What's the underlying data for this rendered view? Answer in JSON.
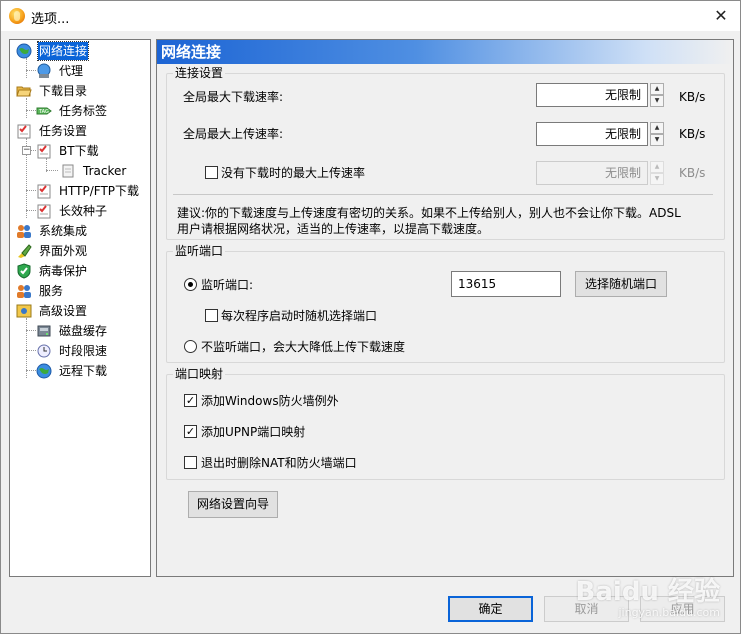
{
  "window": {
    "title": "选项..."
  },
  "tree": {
    "items": [
      {
        "label": "网络连接",
        "icon": "globe-icon",
        "selected": true
      },
      {
        "label": "代理",
        "icon": "network-icon"
      },
      {
        "label": "下载目录",
        "icon": "folder-open-icon"
      },
      {
        "label": "任务标签",
        "icon": "tag-icon"
      },
      {
        "label": "任务设置",
        "icon": "task-icon"
      },
      {
        "label": "BT下载",
        "icon": "task-icon"
      },
      {
        "label": "Tracker",
        "icon": "page-icon"
      },
      {
        "label": "HTTP/FTP下载",
        "icon": "task-icon"
      },
      {
        "label": "长效种子",
        "icon": "task-icon"
      },
      {
        "label": "系统集成",
        "icon": "users-icon"
      },
      {
        "label": "界面外观",
        "icon": "brush-icon"
      },
      {
        "label": "病毒保护",
        "icon": "shield-icon"
      },
      {
        "label": "服务",
        "icon": "users-icon"
      },
      {
        "label": "高级设置",
        "icon": "advanced-icon"
      },
      {
        "label": "磁盘缓存",
        "icon": "disk-icon"
      },
      {
        "label": "时段限速",
        "icon": "clock-icon"
      },
      {
        "label": "远程下载",
        "icon": "globe-icon"
      }
    ]
  },
  "panel": {
    "header": "网络连接",
    "connection": {
      "title": "连接设置",
      "max_download_label": "全局最大下载速率:",
      "max_download_value": "无限制",
      "max_upload_label": "全局最大上传速率:",
      "max_upload_value": "无限制",
      "idle_upload_label": "没有下载时的最大上传速率",
      "idle_upload_value": "无限制",
      "unit": "KB/s",
      "advice_line1": "建议:你的下载速度与上传速度有密切的关系。如果不上传给别人，别人也不会让你下载。ADSL",
      "advice_line2": "用户请根据网络状况，适当的上传速率，以提高下载速度。"
    },
    "listen": {
      "title": "监听端口",
      "listen_label": "监听端口:",
      "port_value": "13615",
      "random_port_button": "选择随机端口",
      "random_on_start_label": "每次程序启动时随机选择端口",
      "no_listen_label": "不监听端口，会大大降低上传下载速度"
    },
    "mapping": {
      "title": "端口映射",
      "firewall_label": "添加Windows防火墙例外",
      "firewall_checked": true,
      "upnp_label": "添加UPNP端口映射",
      "upnp_checked": true,
      "remove_nat_label": "退出时删除NAT和防火墙端口",
      "remove_nat_checked": false
    },
    "wizard_button": "网络设置向导"
  },
  "footer": {
    "ok": "确定",
    "cancel": "取消",
    "apply": "应用"
  },
  "watermark": {
    "text": "Baidu 经验",
    "url": "jingyan.baidu.com"
  },
  "colors": {
    "selection": "#0a64d8",
    "header_start": "#1c64d4"
  }
}
